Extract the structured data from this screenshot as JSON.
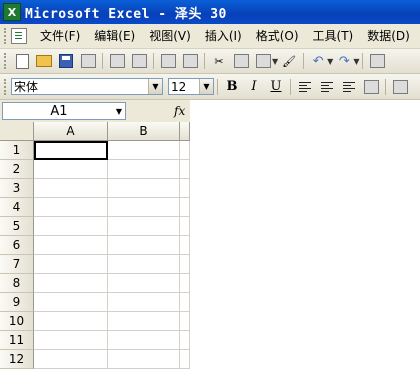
{
  "window": {
    "title": "Microsoft Excel - 泽头 30",
    "app_icon": "excel-icon"
  },
  "menu": {
    "items": [
      {
        "label": "文件(F)"
      },
      {
        "label": "编辑(E)"
      },
      {
        "label": "视图(V)"
      },
      {
        "label": "插入(I)"
      },
      {
        "label": "格式(O)"
      },
      {
        "label": "工具(T)"
      },
      {
        "label": "数据(D)"
      }
    ]
  },
  "format_toolbar": {
    "font": "宋体",
    "size": "12",
    "bold": "B",
    "italic": "I",
    "underline": "U"
  },
  "formula_bar": {
    "name_box": "A1",
    "fx": "fx"
  },
  "sheet": {
    "columns": [
      "A",
      "B"
    ],
    "rows": [
      "1",
      "2",
      "3",
      "4",
      "5",
      "6",
      "7",
      "8",
      "9",
      "10",
      "11",
      "12"
    ]
  }
}
